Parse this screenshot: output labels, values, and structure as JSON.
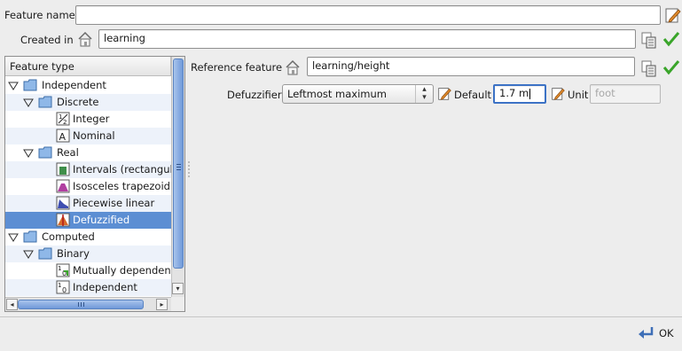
{
  "feature_name": {
    "label": "Feature name",
    "value": ""
  },
  "created_in": {
    "label": "Created in",
    "value": "learning"
  },
  "tree": {
    "header": "Feature type",
    "items": [
      {
        "label": "Independent",
        "icon": "folder-icon",
        "expanded": true
      },
      {
        "label": "Discrete",
        "icon": "folder-icon",
        "expanded": true
      },
      {
        "label": "Integer",
        "icon": "integer-icon"
      },
      {
        "label": "Nominal",
        "icon": "nominal-icon"
      },
      {
        "label": "Real",
        "icon": "folder-icon",
        "expanded": true
      },
      {
        "label": "Intervals (rectangul",
        "icon": "intervals-icon"
      },
      {
        "label": "Isosceles trapezoid",
        "icon": "trapezoid-icon"
      },
      {
        "label": "Piecewise linear",
        "icon": "piecewise-icon"
      },
      {
        "label": "Defuzzified",
        "icon": "defuzzified-icon",
        "selected": true
      },
      {
        "label": "Computed",
        "icon": "folder-icon",
        "expanded": true
      },
      {
        "label": "Binary",
        "icon": "folder-icon",
        "expanded": true
      },
      {
        "label": "Mutually dependent",
        "icon": "binary-icon"
      },
      {
        "label": "Independent",
        "icon": "binary-icon"
      }
    ]
  },
  "reference_feature": {
    "label": "Reference feature",
    "value": "learning/height"
  },
  "defuzzifier": {
    "label": "Defuzzifier",
    "selected": "Leftmost maximum"
  },
  "default": {
    "label": "Default",
    "value": "1.7 m"
  },
  "unit": {
    "label": "Unit",
    "placeholder": "foot"
  },
  "ok_button": {
    "label": "OK"
  },
  "colors": {
    "selection": "#5c8ed3",
    "accept": "#3aa52a",
    "scroll_thumb": "#6f99d9"
  }
}
